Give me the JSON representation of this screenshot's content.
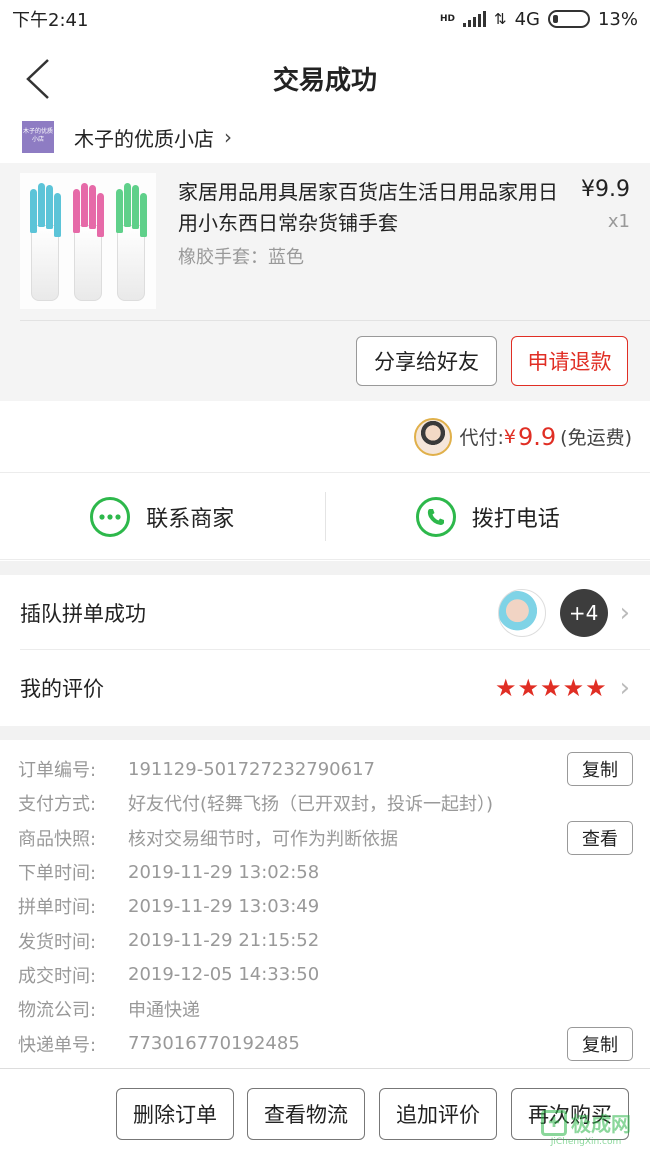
{
  "status_bar": {
    "time": "下午2:41",
    "hd": "HD",
    "network": "4G",
    "battery": "13%"
  },
  "header": {
    "title": "交易成功"
  },
  "shop": {
    "logo_text": "木子的优质小店",
    "name": "木子的优质小店"
  },
  "product": {
    "title": "家居用品用具居家百货店生活日用品家用日用小东西日常杂货铺手套",
    "spec": "橡胶手套：蓝色",
    "price": "¥9.9",
    "qty": "x1",
    "share_label": "分享给好友",
    "refund_label": "申请退款",
    "glove_colors": [
      "#5cc4d8",
      "#e66aa8",
      "#5fd08a"
    ]
  },
  "payment": {
    "label": "代付:",
    "currency": "¥",
    "amount": "9.9",
    "shipping_note": "(免运费)"
  },
  "contact": {
    "merchant_label": "联系商家",
    "phone_label": "拨打电话"
  },
  "group": {
    "label": "插队拼单成功",
    "more_count": "+4"
  },
  "review": {
    "label": "我的评价",
    "stars": 5
  },
  "order_info": [
    {
      "label": "订单编号:",
      "value": "191129-501727232790617",
      "action": "复制"
    },
    {
      "label": "支付方式:",
      "value": "好友代付(轻舞飞扬（已开双封，投诉一起封）)",
      "action": ""
    },
    {
      "label": "商品快照:",
      "value": "核对交易细节时，可作为判断依据",
      "action": "查看"
    },
    {
      "label": "下单时间:",
      "value": "2019-11-29 13:02:58",
      "action": ""
    },
    {
      "label": "拼单时间:",
      "value": "2019-11-29 13:03:49",
      "action": ""
    },
    {
      "label": "发货时间:",
      "value": "2019-11-29 21:15:52",
      "action": ""
    },
    {
      "label": "成交时间:",
      "value": "2019-12-05 14:33:50",
      "action": ""
    },
    {
      "label": "物流公司:",
      "value": "申通快递",
      "action": ""
    },
    {
      "label": "快递单号:",
      "value": "773016770192485",
      "action": "复制"
    }
  ],
  "bottom_actions": [
    "删除订单",
    "查看物流",
    "追加评价",
    "再次购买"
  ],
  "watermark": {
    "cn": "极成网",
    "en": "JiChengXin.com"
  },
  "colors": {
    "accent": "#e02e24",
    "wechat_green": "#2db84b",
    "muted": "#999999"
  }
}
